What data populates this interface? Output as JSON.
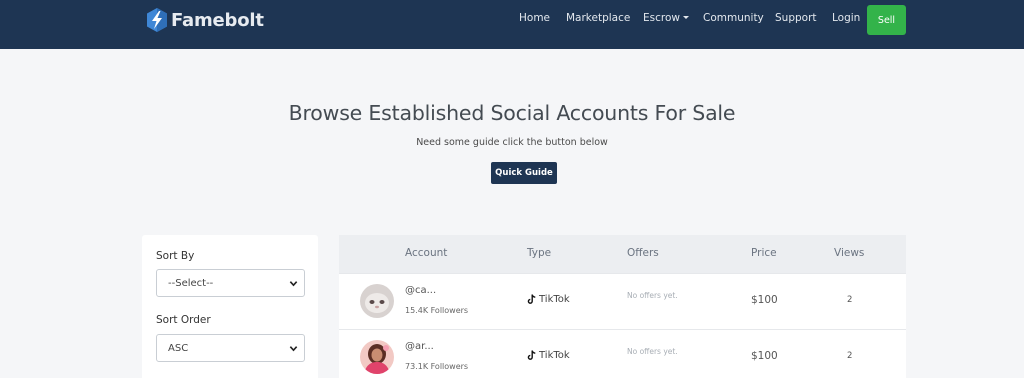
{
  "brand": {
    "name": "Famebolt",
    "icon": "bolt-hexagon-logo"
  },
  "nav": {
    "items": [
      {
        "label": "Home"
      },
      {
        "label": "Marketplace"
      },
      {
        "label": "Escrow"
      },
      {
        "label": "Community"
      },
      {
        "label": "Support"
      },
      {
        "label": "Login"
      }
    ],
    "sell_label": "Sell"
  },
  "hero": {
    "title": "Browse Established Social Accounts For Sale",
    "subtitle": "Need some guide click the button below",
    "button_label": "Quick Guide"
  },
  "filters": {
    "sort_by_label": "Sort By",
    "sort_by_value": "--Select--",
    "sort_order_label": "Sort Order",
    "sort_order_value": "ASC"
  },
  "table": {
    "headers": [
      "Account",
      "Type",
      "Offers",
      "Price",
      "Views"
    ],
    "rows": [
      {
        "handle": "@ca...",
        "followers": "15.4K Followers",
        "type": "TikTok",
        "offers": "No offers yet.",
        "price": "$100",
        "views": "2"
      },
      {
        "handle": "@ar...",
        "followers": "73.1K Followers",
        "type": "TikTok",
        "offers": "No offers yet.",
        "price": "$100",
        "views": "2"
      }
    ]
  },
  "colors": {
    "navbar": "#1e3553",
    "sell_button": "#33b34a",
    "page_background": "#f5f6f8"
  }
}
